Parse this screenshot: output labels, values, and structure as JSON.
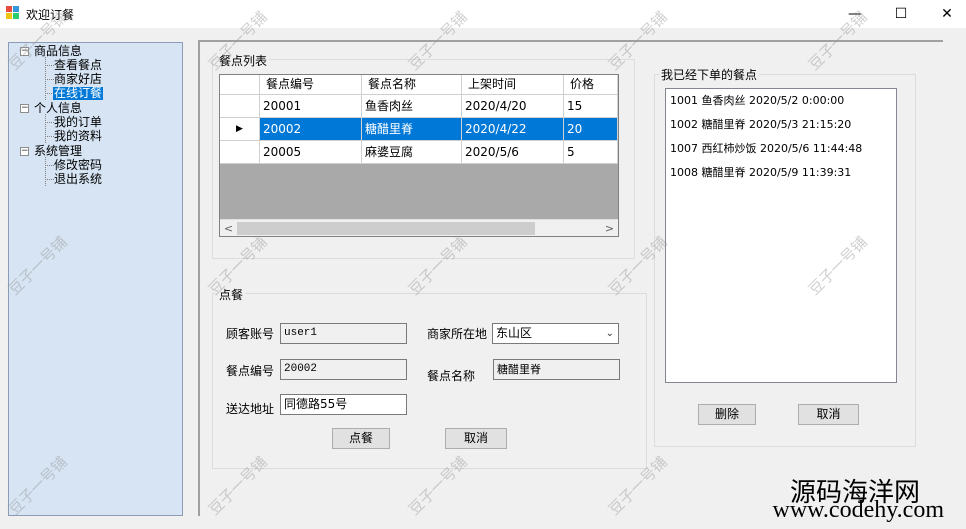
{
  "window": {
    "title": "欢迎订餐",
    "minimize": "—",
    "maximize": "☐",
    "close": "✕"
  },
  "tree": {
    "nodes": [
      {
        "label": "商品信息",
        "toggle": "−"
      },
      {
        "label": "查看餐点"
      },
      {
        "label": "商家好店"
      },
      {
        "label": "在线订餐"
      },
      {
        "label": "个人信息",
        "toggle": "−"
      },
      {
        "label": "我的订单"
      },
      {
        "label": "我的资料"
      },
      {
        "label": "系统管理",
        "toggle": "−"
      },
      {
        "label": "修改密码"
      },
      {
        "label": "退出系统"
      }
    ]
  },
  "menu_list": {
    "title": "餐点列表",
    "columns": [
      "餐点编号",
      "餐点名称",
      "上架时间",
      "价格"
    ],
    "rows": [
      [
        "20001",
        "鱼香肉丝",
        "2020/4/20",
        "15"
      ],
      [
        "20002",
        "糖醋里脊",
        "2020/4/22",
        "20"
      ],
      [
        "20005",
        "麻婆豆腐",
        "2020/5/6",
        "5"
      ]
    ],
    "selected_row": 1,
    "row_indicator": "▶",
    "scroll_left": "<",
    "scroll_right": ">"
  },
  "order_form": {
    "title": "点餐",
    "customer_label": "顾客账号",
    "customer_value": "user1",
    "region_label": "商家所在地",
    "region_value": "东山区",
    "dish_id_label": "餐点编号",
    "dish_id_value": "20002",
    "dish_name_label": "餐点名称",
    "dish_name_value": "糖醋里脊",
    "address_label": "送达地址",
    "address_value": "同德路55号",
    "order_button": "点餐",
    "cancel_button": "取消"
  },
  "my_orders": {
    "title": "我已经下单的餐点",
    "items": [
      "1001 鱼香肉丝 2020/5/2 0:00:00",
      "1002 糖醋里脊 2020/5/3 21:15:20",
      "1007 西红柿炒饭 2020/5/6 11:44:48",
      "1008 糖醋里脊 2020/5/9 11:39:31"
    ],
    "delete_button": "删除",
    "cancel_button": "取消"
  },
  "watermark": {
    "text": "豆子一号铺",
    "brand_line1": "源码海洋网",
    "brand_line2": "www.codehy.com"
  },
  "colors": {
    "selection": "#0078d7",
    "tree_bg": "#d6e4f3"
  }
}
